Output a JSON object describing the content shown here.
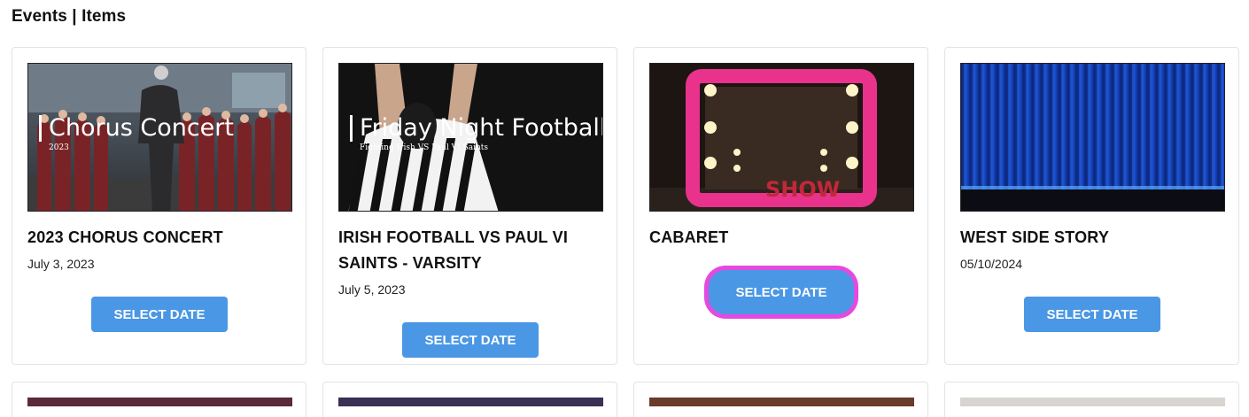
{
  "page": {
    "title": "Events | Items"
  },
  "cards": [
    {
      "title": "2023 CHORUS CONCERT",
      "date": "July 3, 2023",
      "button_label": "SELECT DATE",
      "image": {
        "overlay_title": "Chorus Concert",
        "overlay_sub": "2023"
      }
    },
    {
      "title": "IRISH FOOTBALL VS PAUL VI SAINTS - VARSITY",
      "date": "July 5, 2023",
      "button_label": "SELECT DATE",
      "image": {
        "overlay_title": "Friday Night Football",
        "overlay_sub": "Fighting Irish VS Paul VI Saints"
      }
    },
    {
      "title": "CABARET",
      "date": "",
      "button_label": "SELECT DATE",
      "image": {
        "overlay_title": "",
        "overlay_sub": "",
        "sign_text": "SHOW"
      }
    },
    {
      "title": "WEST SIDE STORY",
      "date": "05/10/2024",
      "button_label": "SELECT DATE",
      "image": {
        "overlay_title": "",
        "overlay_sub": ""
      }
    }
  ],
  "colors": {
    "button": "#4a97e5",
    "highlight": "#e44ae0",
    "card_border": "#e3e3e3"
  }
}
